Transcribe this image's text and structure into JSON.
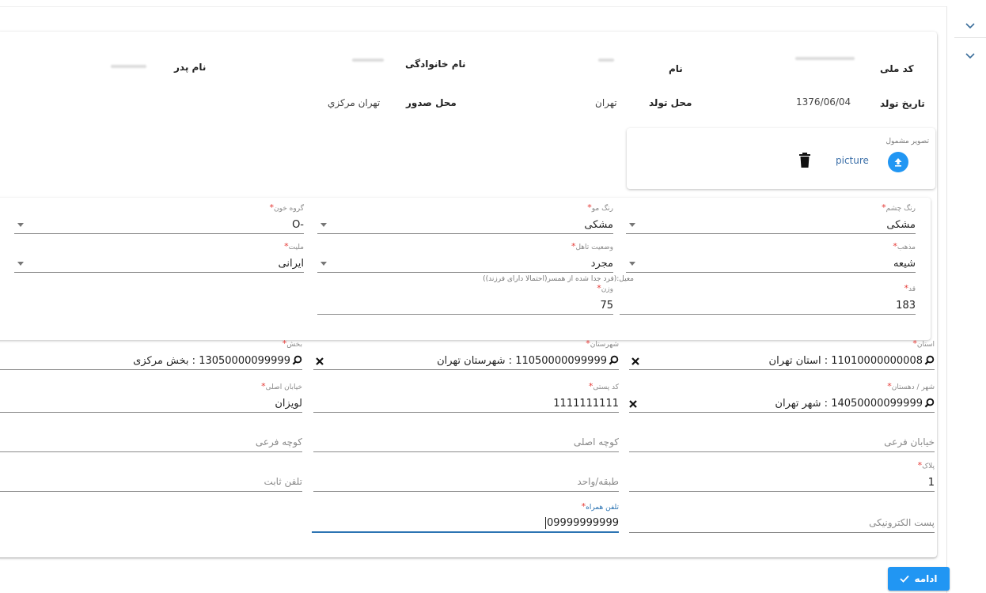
{
  "personal": {
    "national_code_label": "کد ملی",
    "first_name_label": "نام",
    "last_name_label": "نام خانوادگی",
    "father_name_label": "نام پدر",
    "birth_date_label": "تاریخ تولد",
    "birth_date_value": "1376/06/04",
    "birth_place_label": "محل تولد",
    "birth_place_value": "تهران",
    "issue_place_label": "محل صدور",
    "issue_place_value": "تهران مرکزي"
  },
  "photo": {
    "title": "تصویر مشمول",
    "file_link": "picture"
  },
  "traits": {
    "eye_color": {
      "label": "رنگ چشم",
      "value": "مشکی"
    },
    "hair_color": {
      "label": "رنگ مو",
      "value": "مشکی"
    },
    "blood_type": {
      "label": "گروه خون",
      "value": "-O"
    },
    "religion": {
      "label": "مذهب",
      "value": "شیعه"
    },
    "marital": {
      "label": "وضعیت تاهل",
      "value": "مجرد",
      "hint": "معیل:(فرد جدا شده از همسر(احتمالا دارای فرزند))"
    },
    "nationality": {
      "label": "ملیت",
      "value": "ایرانی"
    },
    "height": {
      "label": "قد",
      "value": "183"
    },
    "weight": {
      "label": "وزن",
      "value": "75"
    }
  },
  "address": {
    "province": {
      "label": "استان",
      "value": "11010000000008 : استان تهران"
    },
    "county": {
      "label": "شهرستان",
      "value": "11050000099999 : شهرستان تهران"
    },
    "district": {
      "label": "بخش",
      "value": "13050000099999 : بخش مرکزی"
    },
    "city": {
      "label": "شهر / دهستان",
      "value": "14050000099999 : شهر تهران"
    },
    "postal_code": {
      "label": "کد پستی",
      "value": "1111111111"
    },
    "main_street": {
      "label": "خیابان اصلی",
      "value": "لویزان"
    },
    "side_street_placeholder": "خیابان فرعی",
    "main_alley_placeholder": "کوچه اصلی",
    "side_alley_placeholder": "کوچه فرعی",
    "plate": {
      "label": "پلاک",
      "value": "1"
    },
    "floor_unit_placeholder": "طبقه/واحد",
    "landline_placeholder": "تلفن ثابت",
    "email_placeholder": "پست الکترونیکی",
    "mobile": {
      "label": "تلفن همراه",
      "value": "09999999999"
    }
  },
  "actions": {
    "continue_label": "ادامه"
  },
  "colors": {
    "accent": "#2196f3",
    "required": "#e53935",
    "link": "#3b6fa8"
  }
}
